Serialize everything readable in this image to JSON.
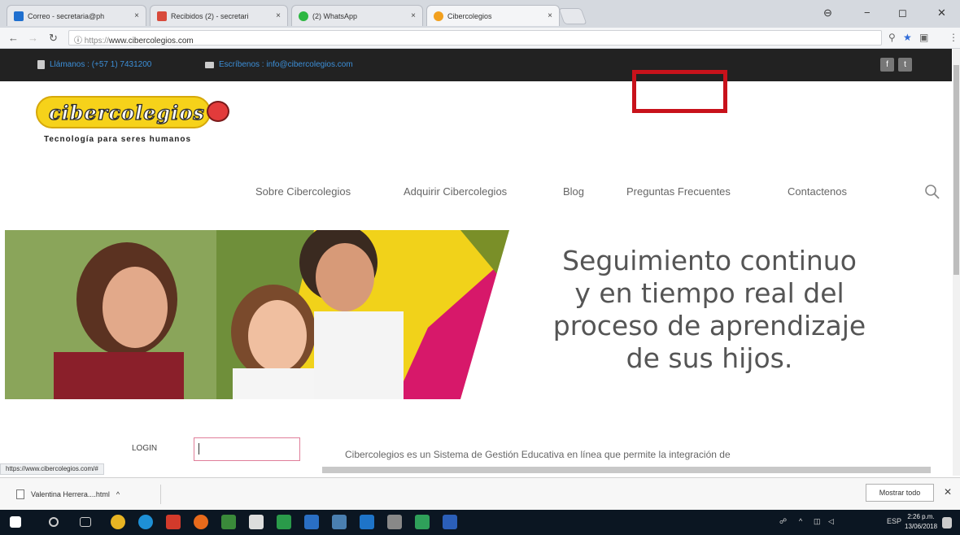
{
  "browser": {
    "tabs": [
      {
        "title": "Correo - secretaria@ph",
        "favicon_color": "#1f6fcf"
      },
      {
        "title": "Recibidos (2) - secretari",
        "favicon_color": "#d84a3b"
      },
      {
        "title": "(2) WhatsApp",
        "favicon_color": "#2db742"
      },
      {
        "title": "Cibercolegios",
        "favicon_color": "#f2a01e"
      }
    ],
    "tab_close": "×",
    "window_controls": [
      "−",
      "◻",
      "✕"
    ],
    "url_scheme": "https://",
    "url_host": "www.cibercolegios.com"
  },
  "site": {
    "contact_phone": "Llámanos : (+57 1) 7431200",
    "contact_email": "Escríbenos : info@cibercolegios.com",
    "social": [
      "f",
      "t"
    ],
    "logo_text": "cibercolegios",
    "logo_tagline": "Tecnología para seres humanos",
    "menu": [
      "Sobre Cibercolegios",
      "Adquirir Cibercolegios",
      "Blog",
      "Preguntas Frecuentes",
      "Contactenos"
    ],
    "hero_lines": [
      "Seguimiento continuo",
      "y en tiempo real del",
      "proceso de aprendizaje",
      "de sus hijos."
    ],
    "login_label": "LOGIN",
    "login_value": "",
    "intro_text": "Cibercolegios es un Sistema de Gestión Educativa en línea que permite la integración de"
  },
  "status_url": "https://www.cibercolegios.com/#",
  "downloads": {
    "file_name": "Valentina Herrera....html",
    "chevron": "^",
    "show_all": "Mostrar todo",
    "close": "✕"
  },
  "taskbar": {
    "language": "ESP",
    "time": "2:26 p.m.",
    "date": "13/06/2018"
  },
  "colors": {
    "highlight": "#c8121b",
    "link_blue": "#3c8fd8",
    "logo_yellow": "#f6d21a"
  }
}
